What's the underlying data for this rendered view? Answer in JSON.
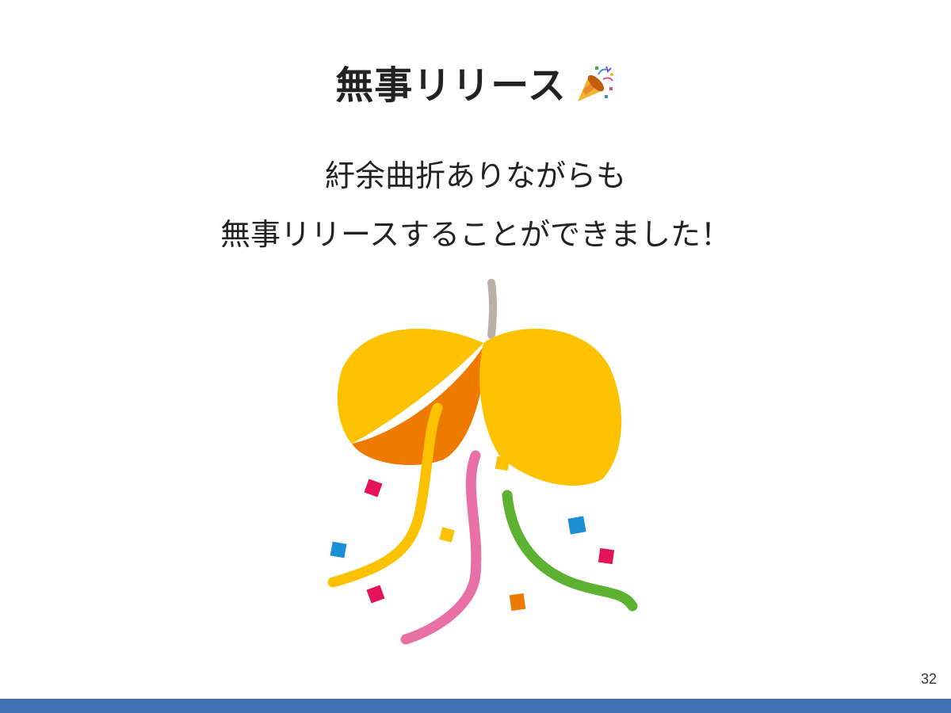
{
  "slide": {
    "title": "無事リリース",
    "title_icon": "party-popper-icon",
    "lines": [
      "紆余曲折ありながらも",
      "無事リリースすることができました！"
    ],
    "page_number": "32",
    "illustration": "kusudama-confetti",
    "colors": {
      "bottom_bar": "#4170b0",
      "ball_yellow": "#fcc200",
      "ball_orange": "#ef7a00",
      "string": "#bcb0a6",
      "streamer_pink": "#e96fa7",
      "streamer_green": "#5cb130",
      "confetti_red": "#e5145a",
      "confetti_blue": "#1a8fd8"
    }
  }
}
